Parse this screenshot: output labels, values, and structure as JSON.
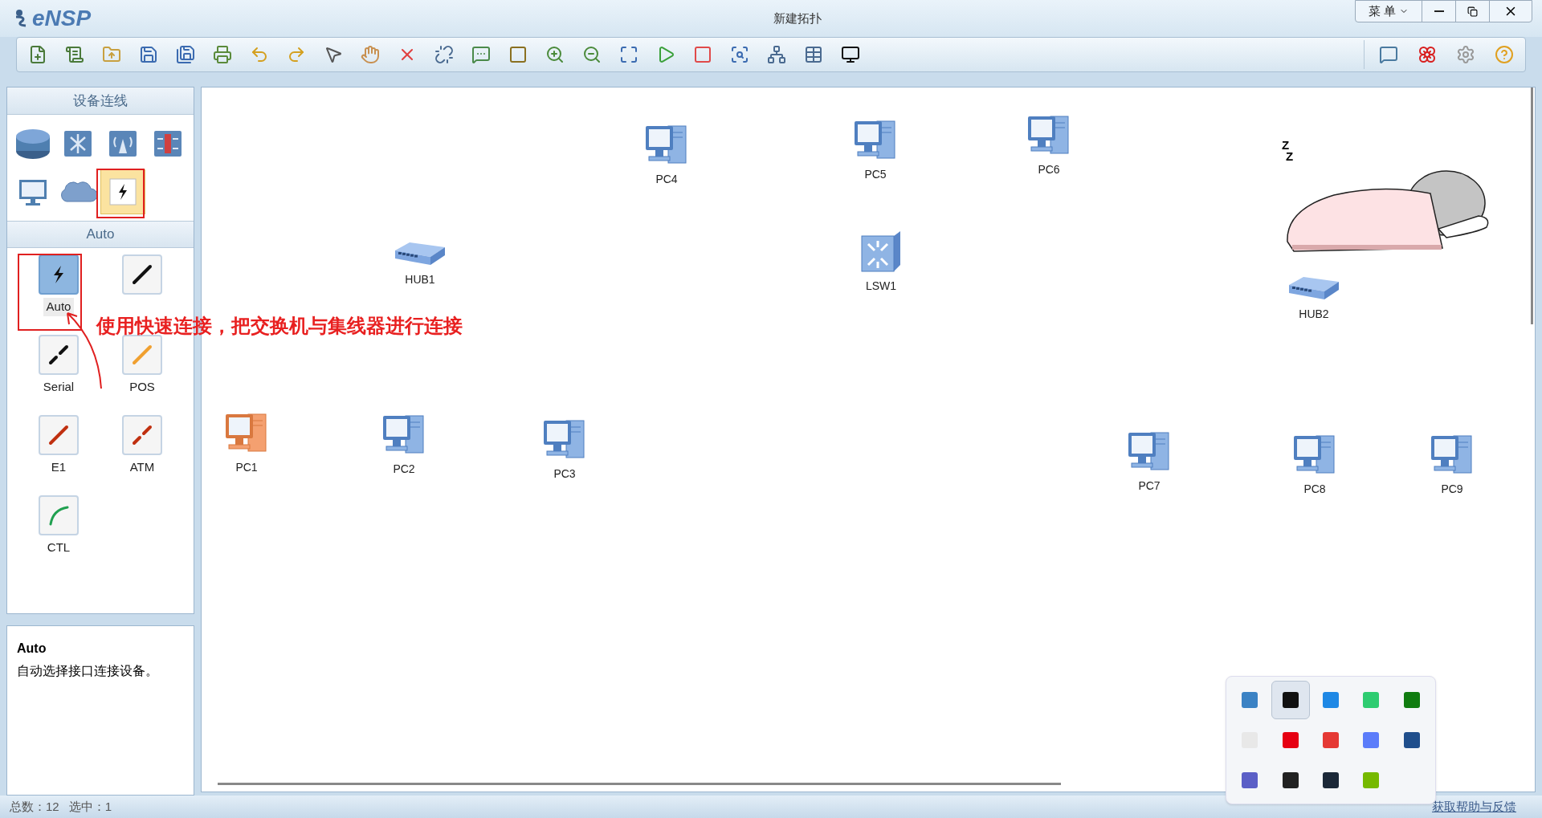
{
  "window": {
    "logo": "eNSP",
    "title": "新建拓扑",
    "menu_button": "菜 单"
  },
  "toolbar": {
    "left": [
      {
        "kind": "new"
      },
      {
        "kind": "new-template"
      },
      {
        "kind": "open"
      },
      {
        "kind": "save"
      },
      {
        "kind": "save-as"
      },
      {
        "kind": "print"
      },
      {
        "kind": "undo"
      },
      {
        "kind": "redo"
      },
      {
        "kind": "select"
      },
      {
        "kind": "pan"
      },
      {
        "kind": "delete"
      },
      {
        "kind": "delete-link"
      },
      {
        "kind": "text"
      },
      {
        "kind": "rectangle"
      },
      {
        "kind": "zoom-in"
      },
      {
        "kind": "zoom-out"
      },
      {
        "kind": "fit"
      },
      {
        "kind": "start"
      },
      {
        "kind": "stop"
      },
      {
        "kind": "capture"
      },
      {
        "kind": "topology"
      },
      {
        "kind": "grid"
      },
      {
        "kind": "console"
      }
    ],
    "toolbar_right": [
      {
        "kind": "comment"
      },
      {
        "kind": "huawei"
      },
      {
        "kind": "settings"
      },
      {
        "kind": "help"
      }
    ]
  },
  "sidebar": {
    "devices_title": "设备连线",
    "devices": [
      {
        "kind": "router",
        "selected": false
      },
      {
        "kind": "switch",
        "selected": false
      },
      {
        "kind": "wireless",
        "selected": false
      },
      {
        "kind": "firewall",
        "selected": false
      },
      {
        "kind": "pc",
        "selected": false
      },
      {
        "kind": "cloud",
        "selected": false
      },
      {
        "kind": "link",
        "selected": true
      }
    ],
    "cables_title": "Auto",
    "cables": [
      {
        "kind": "auto",
        "label": "Auto",
        "selected": true
      },
      {
        "kind": "copper",
        "selected": false
      },
      {
        "kind": "serial",
        "label": "Serial",
        "selected": false
      },
      {
        "kind": "pos",
        "label": "POS",
        "selected": false
      },
      {
        "kind": "e1",
        "label": "E1",
        "selected": false
      },
      {
        "kind": "atm",
        "label": "ATM",
        "selected": false
      },
      {
        "kind": "ctl",
        "label": "CTL",
        "selected": false
      }
    ],
    "description": {
      "title": "Auto",
      "text": "自动选择接口连接设备。"
    }
  },
  "canvas": {
    "devices": [
      {
        "kind": "pc",
        "label": "PC4",
        "selected": false
      },
      {
        "kind": "pc",
        "label": "PC5",
        "selected": false
      },
      {
        "kind": "pc",
        "label": "PC6",
        "selected": false
      },
      {
        "kind": "switch",
        "label": "LSW1",
        "selected": false
      },
      {
        "kind": "hub",
        "label": "HUB1",
        "selected": false
      },
      {
        "kind": "hub",
        "label": "HUB2",
        "selected": false
      },
      {
        "kind": "pc",
        "label": "PC1",
        "selected": true
      },
      {
        "kind": "pc",
        "label": "PC2",
        "selected": false
      },
      {
        "kind": "pc",
        "label": "PC3",
        "selected": false
      },
      {
        "kind": "pc",
        "label": "PC7",
        "selected": false
      },
      {
        "kind": "pc",
        "label": "PC8",
        "selected": false
      },
      {
        "kind": "pc",
        "label": "PC9",
        "selected": false
      }
    ],
    "sticker": {
      "sleep_marks": [
        "Z",
        "Z"
      ]
    }
  },
  "annotation": {
    "text": "使用快速连接，把交换机与集线器进行连接"
  },
  "tray_popup": {
    "icons": [
      {
        "color": "#3b82c4",
        "highlighted": false
      },
      {
        "color": "#111111",
        "highlighted": true
      },
      {
        "color": "#1e88e5",
        "highlighted": false
      },
      {
        "color": "#2ecc71",
        "highlighted": false
      },
      {
        "color": "#107c10",
        "highlighted": false
      },
      {
        "color": "#e8e8e8",
        "highlighted": false
      },
      {
        "color": "#e60012",
        "highlighted": false
      },
      {
        "color": "#e53935",
        "highlighted": false
      },
      {
        "color": "#5b7cfa",
        "highlighted": false
      },
      {
        "color": "#1f4e8c",
        "highlighted": false
      },
      {
        "color": "#5b5fc7",
        "highlighted": false
      },
      {
        "color": "#222222",
        "highlighted": false
      },
      {
        "color": "#1b2838",
        "highlighted": false
      },
      {
        "color": "#76b900",
        "highlighted": false
      }
    ]
  },
  "status_bar": {
    "total_label": "总数：12",
    "selected_label": "选中：1",
    "help_link": "获取帮助与反馈"
  }
}
